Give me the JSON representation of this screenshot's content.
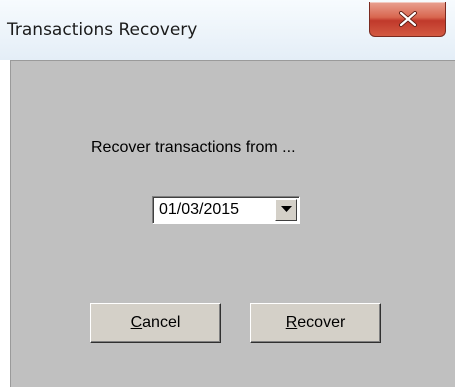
{
  "window": {
    "title": "Transactions Recovery"
  },
  "titlebar": {
    "close_icon": "close-icon",
    "close_color": "#c7432d"
  },
  "dialog": {
    "prompt": "Recover transactions from ...",
    "date_field": {
      "value": "01/03/2015",
      "dropdown_icon": "chevron-down-icon"
    },
    "buttons": {
      "cancel": {
        "mnemonic": "C",
        "rest": "ancel"
      },
      "recover": {
        "mnemonic": "R",
        "rest": "ecover"
      }
    }
  },
  "colors": {
    "panel_background": "#c0c0c0",
    "button_face": "#d4d0c8"
  }
}
